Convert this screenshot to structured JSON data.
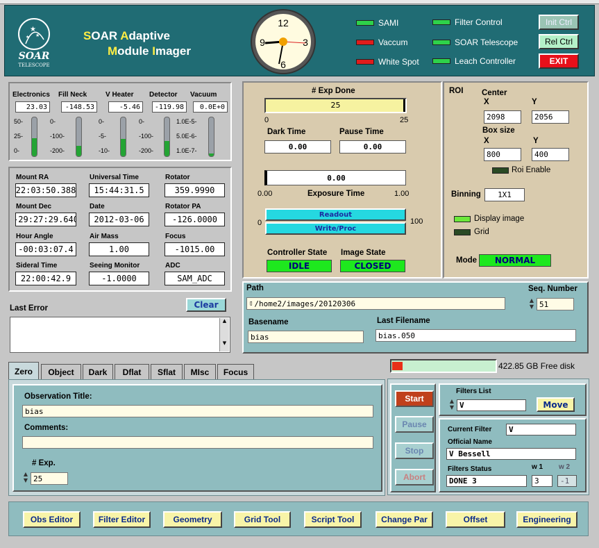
{
  "header": {
    "logo_text": "SOAR",
    "logo_sub": "TELESCOPE",
    "title_line1": {
      "h1": "S",
      "r1": "OAR ",
      "h2": "A",
      "r2": "daptive"
    },
    "title_line2": {
      "h1": "M",
      "r1": "odule ",
      "h2": "I",
      "r2": "mager"
    },
    "clock_numbers": [
      "12",
      "3",
      "6",
      "9"
    ],
    "indicators": [
      {
        "label": "SAMI",
        "state": "green"
      },
      {
        "label": "Vaccum",
        "state": "red"
      },
      {
        "label": "White Spot",
        "state": "red"
      },
      {
        "label": "Filter Control",
        "state": "green"
      },
      {
        "label": "SOAR Telescope",
        "state": "green"
      },
      {
        "label": "Leach Controller",
        "state": "green"
      }
    ],
    "buttons": {
      "init": "Init Ctrl",
      "rel": "Rel Ctrl",
      "exit": "EXIT"
    }
  },
  "sensors": [
    {
      "label": "Electronics",
      "value": "23.03",
      "ticks": [
        "50-",
        "25-",
        "0-"
      ],
      "level": 0.46
    },
    {
      "label": "Fill Neck",
      "value": "-148.53",
      "ticks": [
        "0-",
        "-100-",
        "-200-"
      ],
      "level": 0.26
    },
    {
      "label": "V Heater",
      "value": "-5.46",
      "ticks": [
        "0-",
        "-5-",
        "-10-"
      ],
      "level": 0.45
    },
    {
      "label": "Detector",
      "value": "-119.98",
      "ticks": [
        "0-",
        "-100-",
        "-200-"
      ],
      "level": 0.4
    },
    {
      "label": "Vacuum",
      "value": "0.0E+0",
      "ticks": [
        "1.0E-5-",
        "5.0E-6-",
        "1.0E-7-"
      ],
      "level": 0.08
    }
  ],
  "telemetry": [
    {
      "label": "Mount RA",
      "value": "22:03:50.388"
    },
    {
      "label": "Universal Time",
      "value": "15:44:31.5"
    },
    {
      "label": "Rotator",
      "value": "359.9990"
    },
    {
      "label": "Mount Dec",
      "value": "-29:27:29.640"
    },
    {
      "label": "Date",
      "value": "2012-03-06"
    },
    {
      "label": "Rotator PA",
      "value": "-126.0000"
    },
    {
      "label": "Hour Angle",
      "value": "-00:03:07.4"
    },
    {
      "label": "Air Mass",
      "value": "1.00"
    },
    {
      "label": "Focus",
      "value": "-1015.00"
    },
    {
      "label": "Sideral Time",
      "value": "22:00:42.9"
    },
    {
      "label": "Seeing Monitor",
      "value": "-1.0000"
    },
    {
      "label": "ADC",
      "value": "SAM_ADC"
    }
  ],
  "error": {
    "label": "Last Error",
    "clear": "Clear",
    "text": ""
  },
  "exposure": {
    "exp_done_label": "# Exp Done",
    "exp_done": "25",
    "exp_min": "0",
    "exp_max": "25",
    "exp_fraction": 1.0,
    "dark_label": "Dark Time",
    "dark": "0.00",
    "pause_label": "Pause Time",
    "pause": "0.00",
    "exptime_value": "0.00",
    "exptime_label": "Exposure Time",
    "exptime_min": "0.00",
    "exptime_max": "1.00",
    "readout": "Readout",
    "writeproc": "Write/Proc",
    "prog_min": "0",
    "prog_max": "100",
    "controller_state_label": "Controller State",
    "controller_state": "IDLE",
    "image_state_label": "Image State",
    "image_state": "CLOSED"
  },
  "roi": {
    "title": "ROI",
    "center_label": "Center",
    "x_label": "X",
    "y_label": "Y",
    "center_x": "2098",
    "center_y": "2056",
    "box_label": "Box size",
    "box_x": "800",
    "box_y": "400",
    "enable_label": "Roi Enable",
    "binning_label": "Binning",
    "binning": "1X1",
    "display_label": "Display image",
    "grid_label": "Grid",
    "mode_label": "Mode",
    "mode": "NORMAL"
  },
  "files": {
    "path_label": "Path",
    "path": "/home2/images/20120306",
    "seq_label": "Seq. Number",
    "seq": "51",
    "basename_label": "Basename",
    "basename": "bias",
    "last_label": "Last Filename",
    "last": "bias.050",
    "disk": "422.85 GB Free disk",
    "disk_fraction": 0.1
  },
  "tabs": [
    "Zero",
    "Object",
    "Dark",
    "Dflat",
    "Sflat",
    "MIsc",
    "Focus"
  ],
  "obs": {
    "title_label": "Observation Title:",
    "title": "bias",
    "comments_label": "Comments:",
    "comments": "",
    "nexp_label": "# Exp.",
    "nexp": "25"
  },
  "control": {
    "start": "Start",
    "pause": "Pause",
    "stop": "Stop",
    "abort": "Abort"
  },
  "filters": {
    "list_label": "Filters List",
    "selected": "V",
    "move": "Move",
    "current_label": "Current Filter",
    "current": "V",
    "official_label": "Official Name",
    "official": "V Bessell",
    "status_label": "Filters Status",
    "status": "DONE 3",
    "w1_label": "w 1",
    "w1": "3",
    "w2_label": "w 2",
    "w2": "-1"
  },
  "bottom_buttons": [
    "Obs Editor",
    "Filter Editor",
    "Geometry",
    "Grid Tool",
    "Script Tool",
    "Change Par",
    "Offset",
    "Engineering"
  ],
  "colors": {
    "header": "#206c74",
    "accent_yellow": "#ffee44",
    "status_green": "#1ee81e",
    "readout_cyan": "#25d8e0",
    "exit_red": "#e8101a"
  }
}
